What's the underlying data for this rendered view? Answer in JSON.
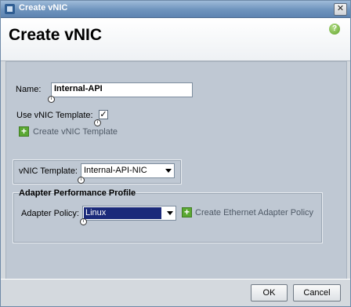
{
  "window": {
    "title": "Create vNIC",
    "close_glyph": "✕"
  },
  "header": {
    "title": "Create vNIC",
    "help_glyph": "?"
  },
  "form": {
    "name_label": "Name:",
    "name_value": "Internal-API",
    "use_template_label": "Use vNIC Template:",
    "use_template_checked": true,
    "check_glyph": "✓",
    "create_template_link": "Create vNIC Template",
    "vnic_template_label": "vNIC Template:",
    "vnic_template_value": "Internal-API-NIC",
    "adapter_group_title": "Adapter Performance Profile",
    "adapter_policy_label": "Adapter Policy:",
    "adapter_policy_value": "Linux",
    "create_adapter_policy_link": "Create Ethernet Adapter Policy",
    "info_glyph": "i",
    "plus_glyph": "+"
  },
  "footer": {
    "ok_label": "OK",
    "cancel_label": "Cancel"
  },
  "colors": {
    "accent_green": "#5aa832",
    "selection_blue": "#1b2a7a",
    "titlebar_blue": "#6e93bd"
  }
}
